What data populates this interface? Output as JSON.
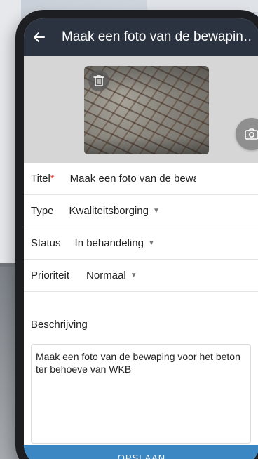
{
  "app_bar": {
    "title": "Maak een foto van de bewapin…",
    "back_icon": "arrow-left-icon"
  },
  "photo": {
    "delete_icon": "trash-icon",
    "camera_icon": "camera-icon"
  },
  "form": {
    "title": {
      "label": "Titel",
      "required_mark": "*",
      "value": "Maak een foto van de bewa"
    },
    "type": {
      "label": "Type",
      "value": "Kwaliteitsborging"
    },
    "status": {
      "label": "Status",
      "value": "In behandeling"
    },
    "priority": {
      "label": "Prioriteit",
      "value": "Normaal"
    },
    "description": {
      "label": "Beschrijving",
      "value": "Maak een foto van de bewaping voor het beton ter behoeve van WKB"
    }
  },
  "save_label": "OPSLAAN",
  "colors": {
    "app_bar": "#2c3340",
    "save_button": "#3a87c3",
    "required": "#e53935",
    "camera_button": "#8f8f8f"
  }
}
